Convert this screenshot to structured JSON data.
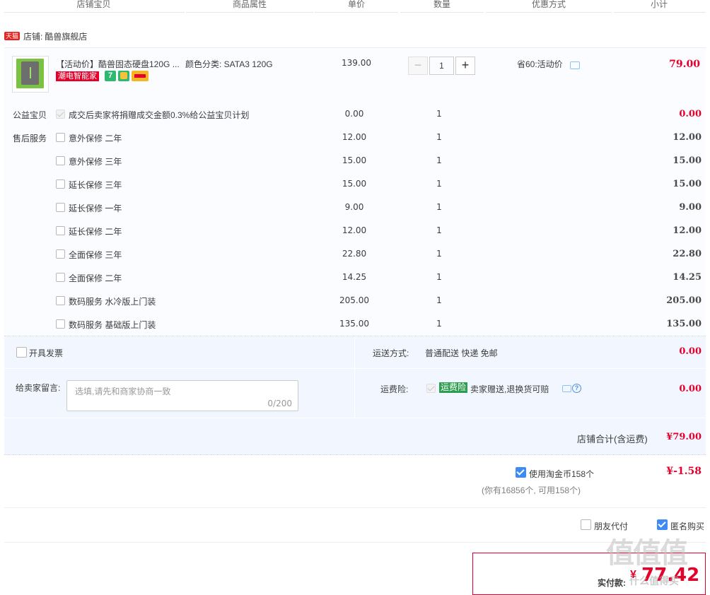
{
  "columns": [
    "店铺宝贝",
    "商品属性",
    "单价",
    "数量",
    "优惠方式",
    "小计"
  ],
  "shop": {
    "tag": "天猫",
    "label": "店铺:",
    "name": "酷兽旗舰店"
  },
  "product": {
    "title": "【活动价】酷兽固态硬盘120G ...",
    "attr": "颜色分类:  SATA3 120G",
    "price": "139.00",
    "quantity": "1",
    "discount": "省60:活动价",
    "subtotal": "79.00",
    "badge": "潮电智能家",
    "badge_color": "#e4002b"
  },
  "charity": {
    "label": "公益宝贝",
    "text": "成交后卖家将捐赠成交金额0.3%给公益宝贝计划",
    "price": "0.00",
    "qty": "1",
    "subtotal": "0.00"
  },
  "services": {
    "label": "售后服务",
    "items": [
      {
        "name": "意外保修  二年",
        "price": "12.00",
        "qty": "1",
        "subtotal": "12.00"
      },
      {
        "name": "意外保修  三年",
        "price": "15.00",
        "qty": "1",
        "subtotal": "15.00"
      },
      {
        "name": "延长保修  三年",
        "price": "15.00",
        "qty": "1",
        "subtotal": "15.00"
      },
      {
        "name": "延长保修  一年",
        "price": "9.00",
        "qty": "1",
        "subtotal": "9.00"
      },
      {
        "name": "延长保修  二年",
        "price": "12.00",
        "qty": "1",
        "subtotal": "12.00"
      },
      {
        "name": "全面保修  三年",
        "price": "22.80",
        "qty": "1",
        "subtotal": "22.80"
      },
      {
        "name": "全面保修  二年",
        "price": "14.25",
        "qty": "1",
        "subtotal": "14.25"
      },
      {
        "name": "数码服务  水冷版上门装",
        "price": "205.00",
        "qty": "1",
        "subtotal": "205.00"
      },
      {
        "name": "数码服务  基础版上门装",
        "price": "135.00",
        "qty": "1",
        "subtotal": "135.00"
      }
    ]
  },
  "invoice": {
    "label": "开具发票"
  },
  "shipping": {
    "label": "运送方式:",
    "value": "普通配送 快递 免邮",
    "cost": "0.00"
  },
  "message": {
    "label": "给卖家留言:",
    "placeholder": "选填,请先和商家协商一致",
    "counter": "0/200"
  },
  "insurance": {
    "label": "运费险:",
    "tag": "运费险",
    "text": "卖家赠送,退换货可赔",
    "cost": "0.00"
  },
  "shop_total": {
    "label": "店铺合计(含运费)",
    "value": "¥79.00"
  },
  "coins": {
    "label": "使用淘金币158个",
    "value": "¥-1.58",
    "note": "(你有16856个, 可用158个)"
  },
  "options": {
    "friend_pay": "朋友代付",
    "anonymous": "匿名购买"
  },
  "payment": {
    "label": "实付款:",
    "currency": "¥",
    "amount": "77.42"
  },
  "watermark": "值值值",
  "watermark_sub": "什么值得买",
  "colors": {
    "price_red": "#e4002b",
    "panel_blue": "#f2f7ff",
    "checkbox_blue": "#3e8bf5",
    "insurance_green": "#2d9e4f"
  }
}
